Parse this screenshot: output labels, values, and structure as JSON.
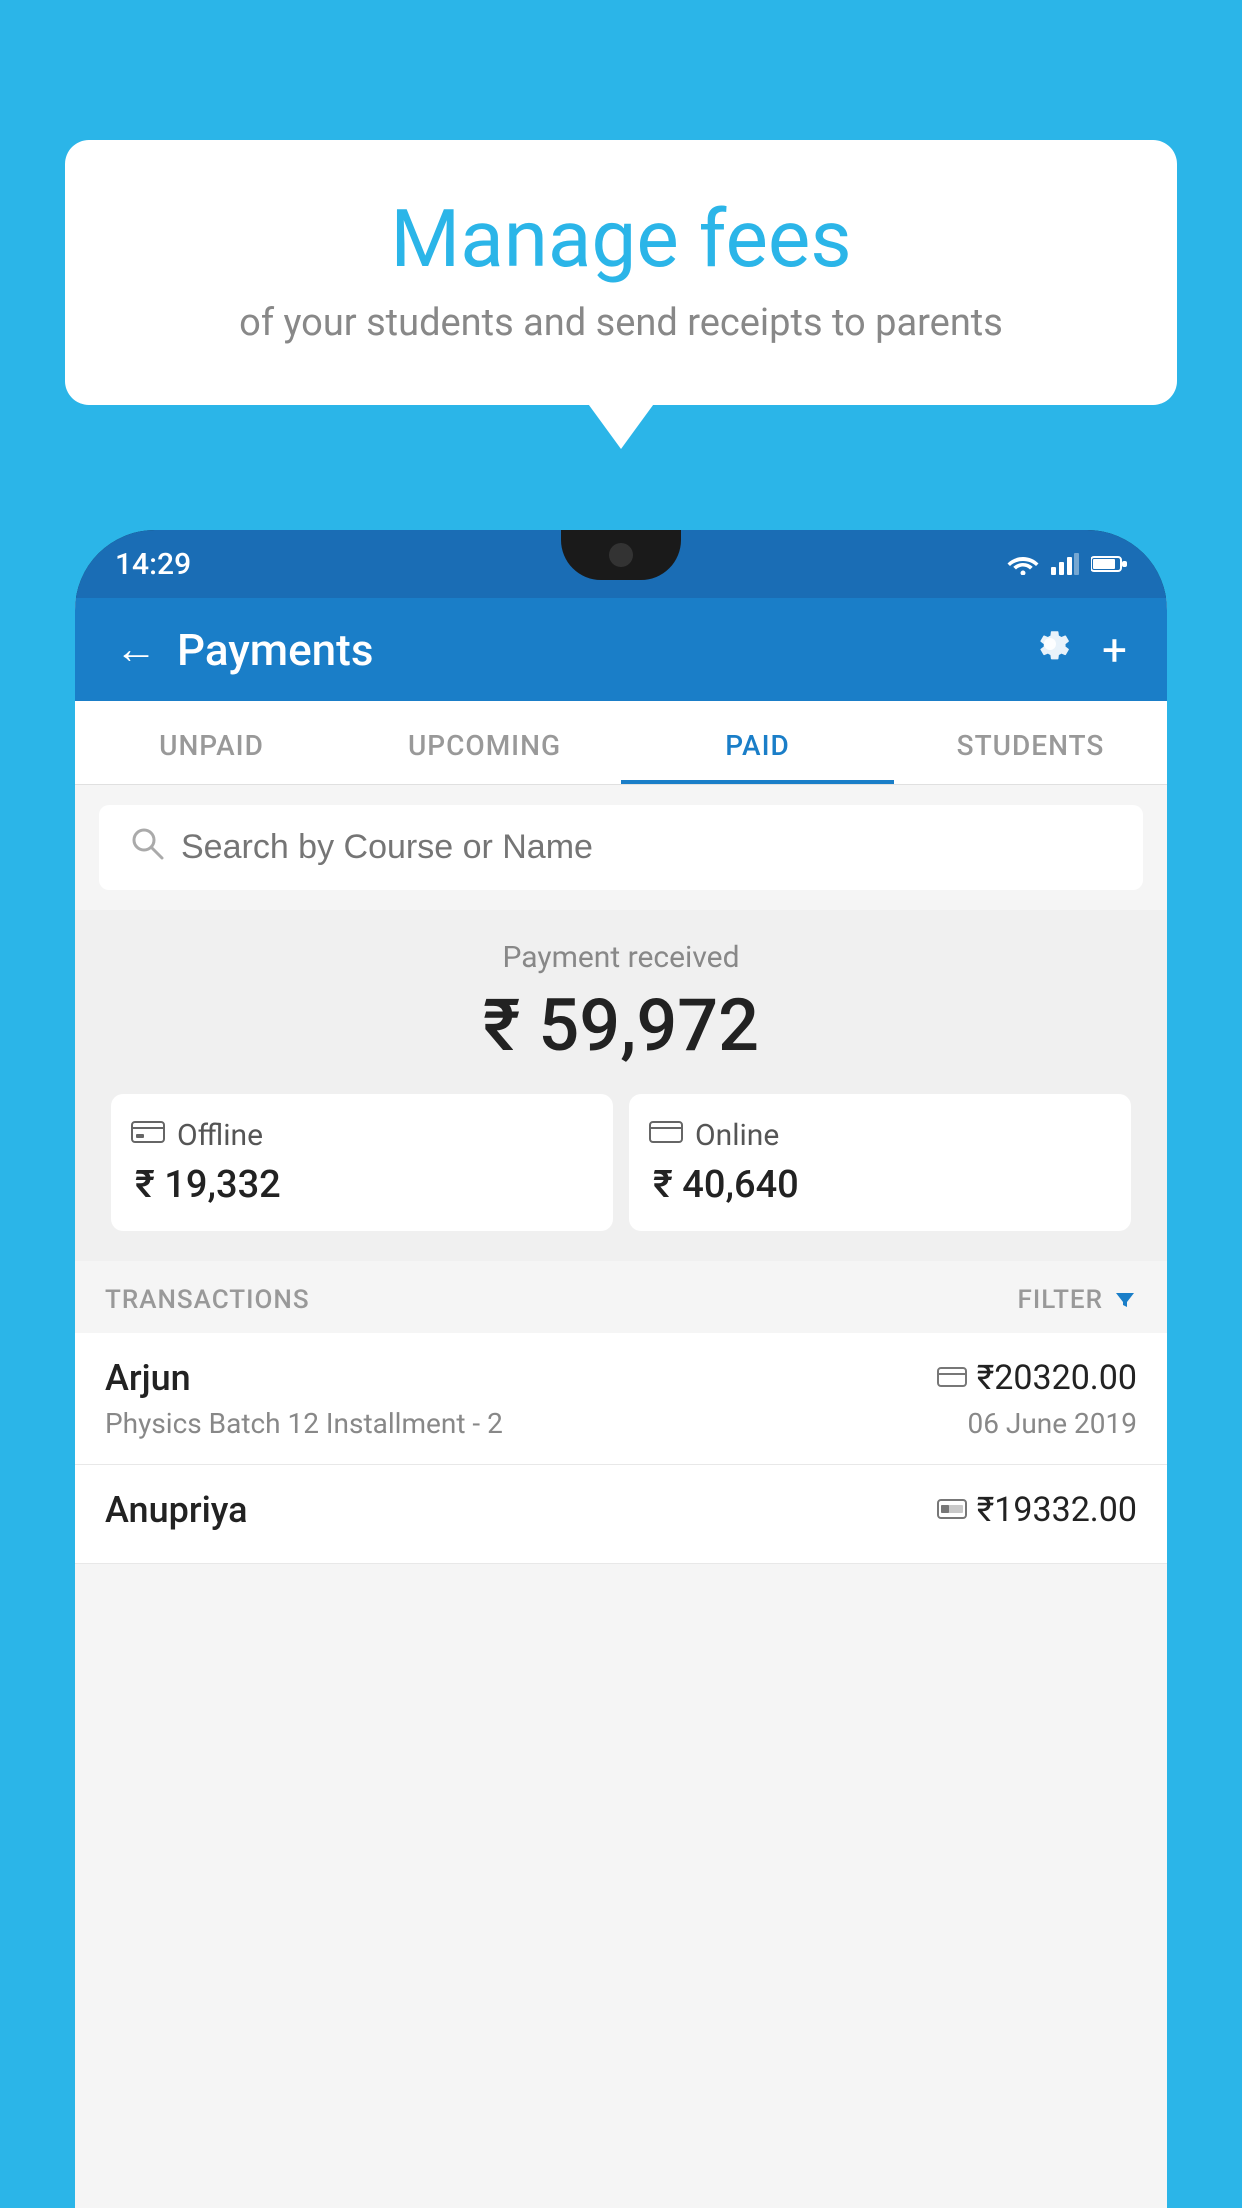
{
  "background_color": "#2bb5e8",
  "bubble": {
    "title": "Manage fees",
    "subtitle": "of your students and send receipts to parents"
  },
  "phone": {
    "status_bar": {
      "time": "14:29"
    },
    "header": {
      "title": "Payments",
      "back_label": "←",
      "gear_label": "⚙",
      "plus_label": "+"
    },
    "tabs": [
      {
        "id": "unpaid",
        "label": "UNPAID",
        "active": false
      },
      {
        "id": "upcoming",
        "label": "UPCOMING",
        "active": false
      },
      {
        "id": "paid",
        "label": "PAID",
        "active": true
      },
      {
        "id": "students",
        "label": "STUDENTS",
        "active": false
      }
    ],
    "search": {
      "placeholder": "Search by Course or Name"
    },
    "payment_summary": {
      "label": "Payment received",
      "total": "₹ 59,972",
      "offline": {
        "label": "Offline",
        "amount": "₹ 19,332"
      },
      "online": {
        "label": "Online",
        "amount": "₹ 40,640"
      }
    },
    "transactions_header": {
      "label": "TRANSACTIONS",
      "filter_label": "FILTER"
    },
    "transactions": [
      {
        "name": "Arjun",
        "amount": "₹20320.00",
        "course": "Physics Batch 12 Installment - 2",
        "date": "06 June 2019",
        "icon": "💳"
      },
      {
        "name": "Anupriya",
        "amount": "₹19332.00",
        "course": "",
        "date": "",
        "icon": "💵"
      }
    ]
  }
}
